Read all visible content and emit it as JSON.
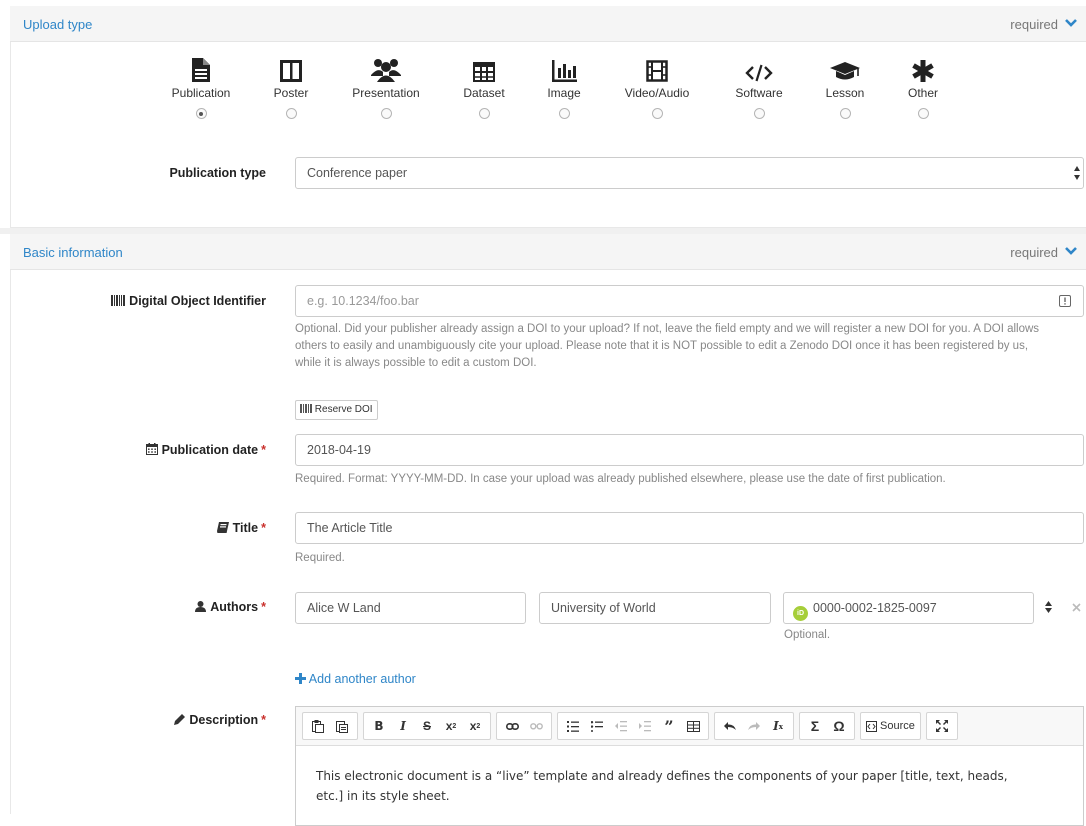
{
  "upload_panel": {
    "title": "Upload type",
    "required": "required",
    "types": [
      {
        "label": "Publication",
        "icon": "file-text-icon",
        "checked": true
      },
      {
        "label": "Poster",
        "icon": "columns-icon",
        "checked": false
      },
      {
        "label": "Presentation",
        "icon": "users-icon",
        "checked": false
      },
      {
        "label": "Dataset",
        "icon": "table-icon",
        "checked": false
      },
      {
        "label": "Image",
        "icon": "bar-chart-icon",
        "checked": false
      },
      {
        "label": "Video/Audio",
        "icon": "film-icon",
        "checked": false
      },
      {
        "label": "Software",
        "icon": "code-icon",
        "checked": false
      },
      {
        "label": "Lesson",
        "icon": "graduation-cap-icon",
        "checked": false
      },
      {
        "label": "Other",
        "icon": "asterisk-icon",
        "checked": false
      }
    ],
    "publication_type_label": "Publication type",
    "publication_type_value": "Conference paper"
  },
  "basic_panel": {
    "title": "Basic information",
    "required": "required",
    "doi": {
      "label": "Digital Object Identifier",
      "placeholder": "e.g. 10.1234/foo.bar",
      "help_lines": [
        "Optional. Did your publisher already assign a DOI to your upload? If not, leave the field empty and we will register a new DOI for you. A DOI allows",
        "others to easily and unambiguously cite your upload. Please note that it is NOT possible to edit a Zenodo DOI once it has been registered by us,",
        "while it is always possible to edit a custom DOI."
      ],
      "reserve_button": "Reserve DOI"
    },
    "publication_date": {
      "label": "Publication date",
      "value": "2018-04-19",
      "help": "Required. Format: YYYY-MM-DD. In case your upload was already published elsewhere, please use the date of first publication."
    },
    "title_field": {
      "label": "Title",
      "value": "The Article Title",
      "help": "Required."
    },
    "authors": {
      "label": "Authors",
      "name": "Alice W Land",
      "affiliation": "University of World",
      "orcid": "0000-0002-1825-0097",
      "orcid_badge": "iD",
      "orcid_help": "Optional.",
      "add_link": "Add another author"
    },
    "description": {
      "label": "Description",
      "source_label": "Source",
      "content_lines": [
        "This electronic document is a “live” template and already defines  the components of your paper [title, text, heads,",
        "etc.] in its style sheet."
      ]
    }
  },
  "colors": {
    "link": "#2f86c8",
    "required_star": "#c9302c",
    "orcid_green": "#a6ce39"
  }
}
